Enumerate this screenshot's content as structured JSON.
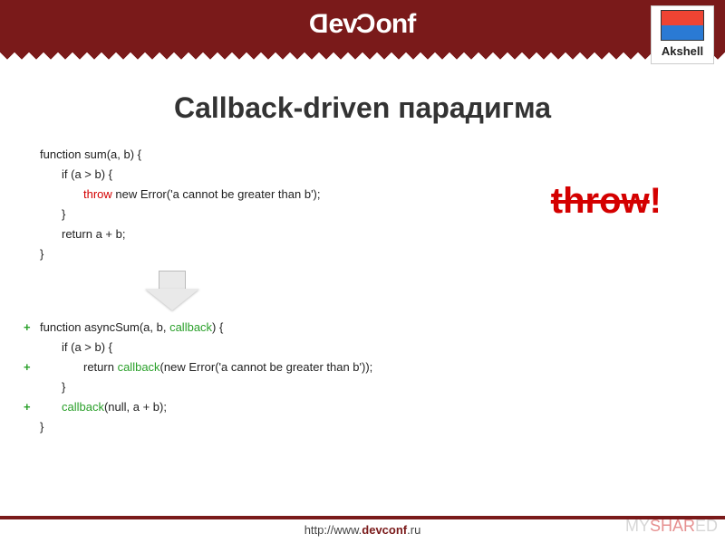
{
  "header": {
    "brand": "DevConf",
    "sponsor": "Akshell"
  },
  "title": "Callback-driven парадигма",
  "callout": {
    "word": "throw",
    "punct": "!"
  },
  "code1": {
    "l1": "function sum(a, b) {",
    "l2": "if (a > b) {",
    "l3a": "throw",
    "l3b": " new Error('a cannot be greater than b');",
    "l4": "}",
    "l5": "return a + b;",
    "l6": "}"
  },
  "code2": {
    "plus": "+",
    "l1a": "function asyncSum(a, b, ",
    "l1b": "callback",
    "l1c": ") {",
    "l2": "if (a > b) {",
    "l3a": "return ",
    "l3b": "callback",
    "l3c": "(new Error('a cannot be greater than b'));",
    "l4": "}",
    "l5a": "callback",
    "l5b": "(null, a + b);",
    "l6": "}"
  },
  "footer": {
    "prefix": "http://www.",
    "bold": "devconf",
    "suffix": ".ru"
  },
  "watermark": {
    "a": "MY",
    "b": "SHAR",
    "c": "ED"
  }
}
